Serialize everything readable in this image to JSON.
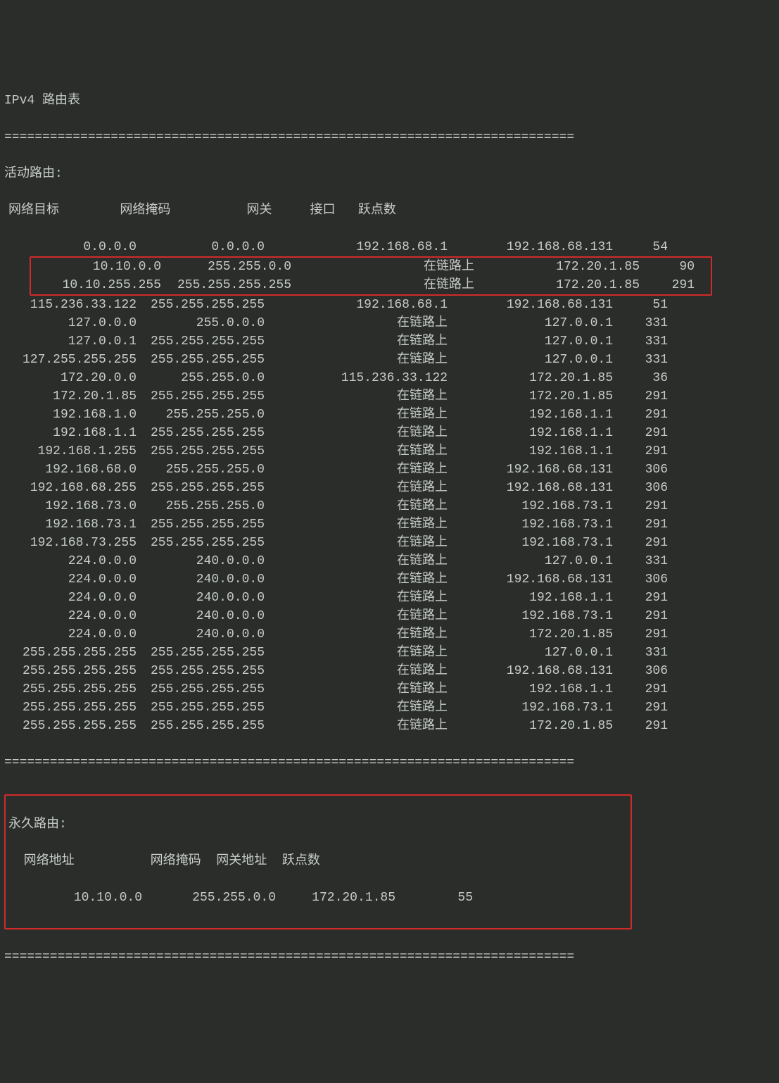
{
  "title": "IPv4 路由表",
  "divider": "===========================================================================",
  "activeLabel": "活动路由:",
  "headers": {
    "dest": "网络目标",
    "mask": "网络掩码",
    "gateway": "网关",
    "iface": "接口",
    "metric": "跃点数"
  },
  "rows": [
    {
      "dest": "0.0.0.0",
      "mask": "0.0.0.0",
      "gw": "192.168.68.1",
      "if": "192.168.68.131",
      "m": "54",
      "hl": false
    },
    {
      "dest": "10.10.0.0",
      "mask": "255.255.0.0",
      "gw": "在链路上",
      "if": "172.20.1.85",
      "m": "90",
      "hl": true
    },
    {
      "dest": "10.10.255.255",
      "mask": "255.255.255.255",
      "gw": "在链路上",
      "if": "172.20.1.85",
      "m": "291",
      "hl": true
    },
    {
      "dest": "115.236.33.122",
      "mask": "255.255.255.255",
      "gw": "192.168.68.1",
      "if": "192.168.68.131",
      "m": "51",
      "hl": false
    },
    {
      "dest": "127.0.0.0",
      "mask": "255.0.0.0",
      "gw": "在链路上",
      "if": "127.0.0.1",
      "m": "331",
      "hl": false
    },
    {
      "dest": "127.0.0.1",
      "mask": "255.255.255.255",
      "gw": "在链路上",
      "if": "127.0.0.1",
      "m": "331",
      "hl": false
    },
    {
      "dest": "127.255.255.255",
      "mask": "255.255.255.255",
      "gw": "在链路上",
      "if": "127.0.0.1",
      "m": "331",
      "hl": false
    },
    {
      "dest": "172.20.0.0",
      "mask": "255.255.0.0",
      "gw": "115.236.33.122",
      "if": "172.20.1.85",
      "m": "36",
      "hl": false
    },
    {
      "dest": "172.20.1.85",
      "mask": "255.255.255.255",
      "gw": "在链路上",
      "if": "172.20.1.85",
      "m": "291",
      "hl": false
    },
    {
      "dest": "192.168.1.0",
      "mask": "255.255.255.0",
      "gw": "在链路上",
      "if": "192.168.1.1",
      "m": "291",
      "hl": false
    },
    {
      "dest": "192.168.1.1",
      "mask": "255.255.255.255",
      "gw": "在链路上",
      "if": "192.168.1.1",
      "m": "291",
      "hl": false
    },
    {
      "dest": "192.168.1.255",
      "mask": "255.255.255.255",
      "gw": "在链路上",
      "if": "192.168.1.1",
      "m": "291",
      "hl": false
    },
    {
      "dest": "192.168.68.0",
      "mask": "255.255.255.0",
      "gw": "在链路上",
      "if": "192.168.68.131",
      "m": "306",
      "hl": false
    },
    {
      "dest": "192.168.68.255",
      "mask": "255.255.255.255",
      "gw": "在链路上",
      "if": "192.168.68.131",
      "m": "306",
      "hl": false
    },
    {
      "dest": "192.168.73.0",
      "mask": "255.255.255.0",
      "gw": "在链路上",
      "if": "192.168.73.1",
      "m": "291",
      "hl": false
    },
    {
      "dest": "192.168.73.1",
      "mask": "255.255.255.255",
      "gw": "在链路上",
      "if": "192.168.73.1",
      "m": "291",
      "hl": false
    },
    {
      "dest": "192.168.73.255",
      "mask": "255.255.255.255",
      "gw": "在链路上",
      "if": "192.168.73.1",
      "m": "291",
      "hl": false
    },
    {
      "dest": "224.0.0.0",
      "mask": "240.0.0.0",
      "gw": "在链路上",
      "if": "127.0.0.1",
      "m": "331",
      "hl": false
    },
    {
      "dest": "224.0.0.0",
      "mask": "240.0.0.0",
      "gw": "在链路上",
      "if": "192.168.68.131",
      "m": "306",
      "hl": false
    },
    {
      "dest": "224.0.0.0",
      "mask": "240.0.0.0",
      "gw": "在链路上",
      "if": "192.168.1.1",
      "m": "291",
      "hl": false
    },
    {
      "dest": "224.0.0.0",
      "mask": "240.0.0.0",
      "gw": "在链路上",
      "if": "192.168.73.1",
      "m": "291",
      "hl": false
    },
    {
      "dest": "224.0.0.0",
      "mask": "240.0.0.0",
      "gw": "在链路上",
      "if": "172.20.1.85",
      "m": "291",
      "hl": false
    },
    {
      "dest": "255.255.255.255",
      "mask": "255.255.255.255",
      "gw": "在链路上",
      "if": "127.0.0.1",
      "m": "331",
      "hl": false
    },
    {
      "dest": "255.255.255.255",
      "mask": "255.255.255.255",
      "gw": "在链路上",
      "if": "192.168.68.131",
      "m": "306",
      "hl": false
    },
    {
      "dest": "255.255.255.255",
      "mask": "255.255.255.255",
      "gw": "在链路上",
      "if": "192.168.1.1",
      "m": "291",
      "hl": false
    },
    {
      "dest": "255.255.255.255",
      "mask": "255.255.255.255",
      "gw": "在链路上",
      "if": "192.168.73.1",
      "m": "291",
      "hl": false
    },
    {
      "dest": "255.255.255.255",
      "mask": "255.255.255.255",
      "gw": "在链路上",
      "if": "172.20.1.85",
      "m": "291",
      "hl": false
    }
  ],
  "permLabel": "永久路由:",
  "permHeaders": {
    "addr": "网络地址",
    "mask": "网络掩码",
    "gwaddr": "网关地址",
    "metric": "跃点数"
  },
  "permRows": [
    {
      "addr": "10.10.0.0",
      "mask": "255.255.0.0",
      "gw": "172.20.1.85",
      "m": "55"
    }
  ]
}
